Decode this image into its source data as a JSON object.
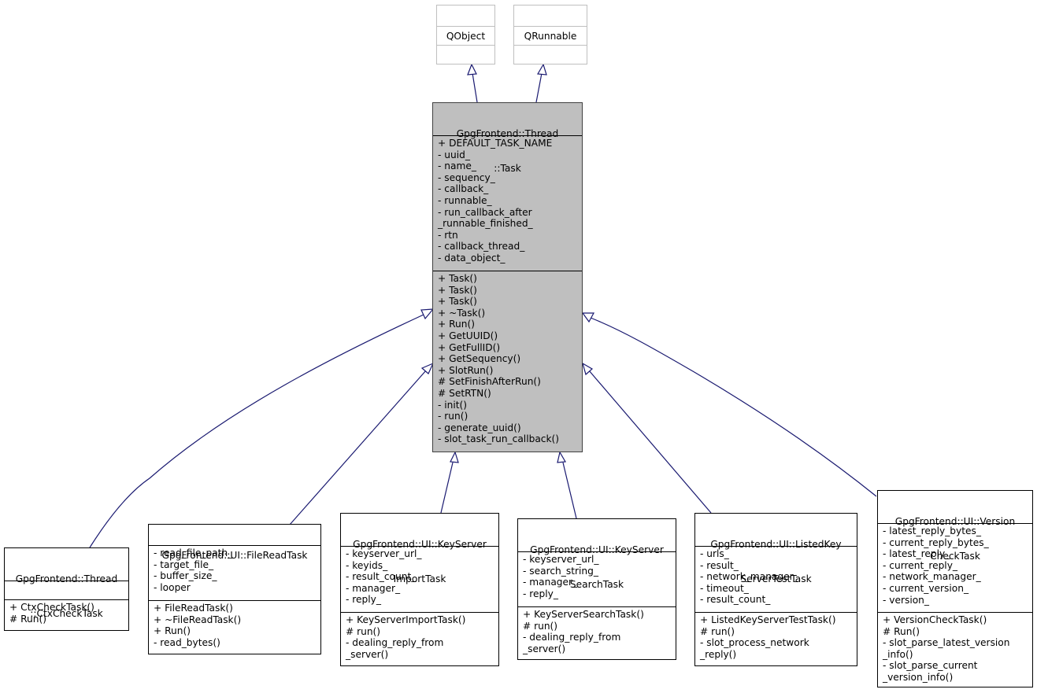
{
  "diagram": {
    "type": "class-inheritance",
    "edge_color": "#191970",
    "focus_fill": "#bfbfbf",
    "classes": {
      "qobject": {
        "title": [
          "QObject"
        ],
        "attributes": [],
        "methods": []
      },
      "qrunnable": {
        "title": [
          "QRunnable"
        ],
        "attributes": [],
        "methods": []
      },
      "task": {
        "title": [
          "GpgFrontend::Thread",
          "::Task"
        ],
        "attributes": [
          "+ DEFAULT_TASK_NAME",
          "- uuid_",
          "- name_",
          "- sequency_",
          "- callback_",
          "- runnable_",
          "- run_callback_after",
          "_runnable_finished_",
          "- rtn",
          "- callback_thread_",
          "- data_object_"
        ],
        "methods": [
          "+ Task()",
          "+ Task()",
          "+ Task()",
          "+ ~Task()",
          "+ Run()",
          "+ GetUUID()",
          "+ GetFullID()",
          "+ GetSequency()",
          "+ SlotRun()",
          "# SetFinishAfterRun()",
          "# SetRTN()",
          "- init()",
          "- run()",
          "- generate_uuid()",
          "- slot_task_run_callback()"
        ]
      },
      "ctxcheck": {
        "title": [
          "GpgFrontend::Thread",
          "::CtxCheckTask"
        ],
        "attributes": [],
        "methods": [
          "+ CtxCheckTask()",
          "# Run()"
        ]
      },
      "fileread": {
        "title": [
          "GpgFrontend::UI::FileReadTask"
        ],
        "attributes": [
          "- read_file_path_",
          "- target_file_",
          "- buffer_size_",
          "- looper"
        ],
        "methods": [
          "+ FileReadTask()",
          "+ ~FileReadTask()",
          "+ Run()",
          "- read_bytes()"
        ]
      },
      "ksimport": {
        "title": [
          "GpgFrontend::UI::KeyServer",
          "ImportTask"
        ],
        "attributes": [
          "- keyserver_url_",
          "- keyids_",
          "- result_count_",
          "- manager_",
          "- reply_"
        ],
        "methods": [
          "+ KeyServerImportTask()",
          "# run()",
          "- dealing_reply_from",
          "_server()"
        ]
      },
      "kssearch": {
        "title": [
          "GpgFrontend::UI::KeyServer",
          "SearchTask"
        ],
        "attributes": [
          "- keyserver_url_",
          "- search_string_",
          "- manager_",
          "- reply_"
        ],
        "methods": [
          "+ KeyServerSearchTask()",
          "# run()",
          "- dealing_reply_from",
          "_server()"
        ]
      },
      "listedks": {
        "title": [
          "GpgFrontend::UI::ListedKey",
          "ServerTestTask"
        ],
        "attributes": [
          "- urls_",
          "- result_",
          "- network_manager_",
          "- timeout_",
          "- result_count_"
        ],
        "methods": [
          "+ ListedKeyServerTestTask()",
          "# run()",
          "- slot_process_network",
          "_reply()"
        ]
      },
      "versioncheck": {
        "title": [
          "GpgFrontend::UI::Version",
          "CheckTask"
        ],
        "attributes": [
          "- latest_reply_bytes_",
          "- current_reply_bytes_",
          "- latest_reply_",
          "- current_reply_",
          "- network_manager_",
          "- current_version_",
          "- version_"
        ],
        "methods": [
          "+ VersionCheckTask()",
          "# Run()",
          "- slot_parse_latest_version",
          "_info()",
          "- slot_parse_current",
          "_version_info()"
        ]
      }
    },
    "edges": [
      {
        "from": "task",
        "to": "qobject",
        "kind": "inherits"
      },
      {
        "from": "task",
        "to": "qrunnable",
        "kind": "inherits"
      },
      {
        "from": "ctxcheck",
        "to": "task",
        "kind": "inherits"
      },
      {
        "from": "fileread",
        "to": "task",
        "kind": "inherits"
      },
      {
        "from": "ksimport",
        "to": "task",
        "kind": "inherits"
      },
      {
        "from": "kssearch",
        "to": "task",
        "kind": "inherits"
      },
      {
        "from": "listedks",
        "to": "task",
        "kind": "inherits"
      },
      {
        "from": "versioncheck",
        "to": "task",
        "kind": "inherits"
      }
    ]
  }
}
